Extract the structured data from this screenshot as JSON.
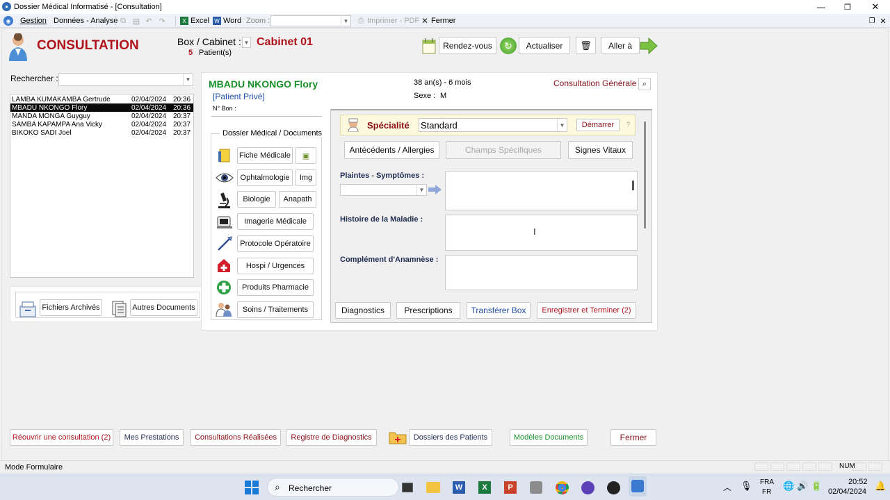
{
  "window": {
    "title": "Dossier Médical Informatisé - [Consultation]"
  },
  "menu": {
    "gestion": "Gestion",
    "donnees": "Données - Analyse",
    "excel": "Excel",
    "word": "Word",
    "zoom_label": "Zoom :",
    "zoom_value": "",
    "imprimer": "Imprimer - PDF",
    "fermer": "Fermer"
  },
  "header": {
    "title": "CONSULTATION",
    "box_label": "Box / Cabinet :",
    "cabinet": "Cabinet 01",
    "patient_count": "5",
    "patients_label": "Patient(s)",
    "rdv": "Rendez-vous",
    "actualiser": "Actualiser",
    "aller": "Aller à"
  },
  "search": {
    "label": "Rechercher :",
    "value": ""
  },
  "patients": [
    {
      "name": "LAMBA KUMAKAMBA Gertrude",
      "date": "02/04/2024",
      "time": "20:36"
    },
    {
      "name": "MBADU NKONGO Flory",
      "date": "02/04/2024",
      "time": "20:36"
    },
    {
      "name": "MANDA MONGA Guyguy",
      "date": "02/04/2024",
      "time": "20:37"
    },
    {
      "name": "SAMBA KAPAMPA Ana Vicky",
      "date": "02/04/2024",
      "time": "20:37"
    },
    {
      "name": "BIKOKO SADI Joel",
      "date": "02/04/2024",
      "time": "20:37"
    }
  ],
  "archive": {
    "fichiers": "Fichiers Archivés",
    "autres": "Autres Documents"
  },
  "patient": {
    "name": "MBADU NKONGO Flory",
    "type": "[Patient Privé]",
    "bon_label": "N° Bon :",
    "age": "38 an(s) - 6 mois",
    "sexe_label": "Sexe :",
    "sexe": "M",
    "consultation_type": "Consultation Générale"
  },
  "dossier": {
    "title": "Dossier Médical / Documents",
    "fiche": "Fiche Médicale",
    "ophtalmo": "Ophtalmologie",
    "img": "Img",
    "biologie": "Biologie",
    "anapath": "Anapath",
    "imagerie": "Imagerie Médicale",
    "protocole": "Protocole Opératoire",
    "hospi": "Hospi / Urgences",
    "pharmacie": "Produits Pharmacie",
    "soins": "Soins / Traitements"
  },
  "form": {
    "specialite_label": "Spécialité",
    "specialite_value": "Standard",
    "demarrer": "Démarrer",
    "help": "?",
    "antecedents": "Antécédents / Allergies",
    "champs": "Champs Spécifiques",
    "signes": "Signes Vitaux",
    "plaintes_label": "Plaintes - Symptômes :",
    "histoire_label": "Histoire de la Maladie :",
    "complement_label": "Complément d'Anamnèse :",
    "plaintes_select": "",
    "plaintes_text": "",
    "histoire_text": "",
    "complement_text": "",
    "diagnostics": "Diagnostics",
    "prescriptions": "Prescriptions",
    "transferer": "Transférer Box",
    "enregistrer": "Enregistrer et Terminer (2)"
  },
  "bottom": {
    "rouvrir": "Réouvrir une consultation (2)",
    "prestations": "Mes Prestations",
    "realisees": "Consultations Réalisées",
    "registre": "Registre de Diagnostics",
    "dossiers": "Dossiers des Patients",
    "modeles": "Modèles Documents",
    "fermer": "Fermer"
  },
  "status": {
    "mode": "Mode Formulaire",
    "num": "NUM"
  },
  "taskbar": {
    "search": "Rechercher",
    "lang1": "FRA",
    "lang2": "FR",
    "time": "20:52",
    "date": "02/04/2024"
  },
  "colors": {
    "accent_red": "#b0121b",
    "patient_green": "#18902a",
    "link_blue": "#1f4ea8",
    "selected_row": "#0a0a0a"
  }
}
